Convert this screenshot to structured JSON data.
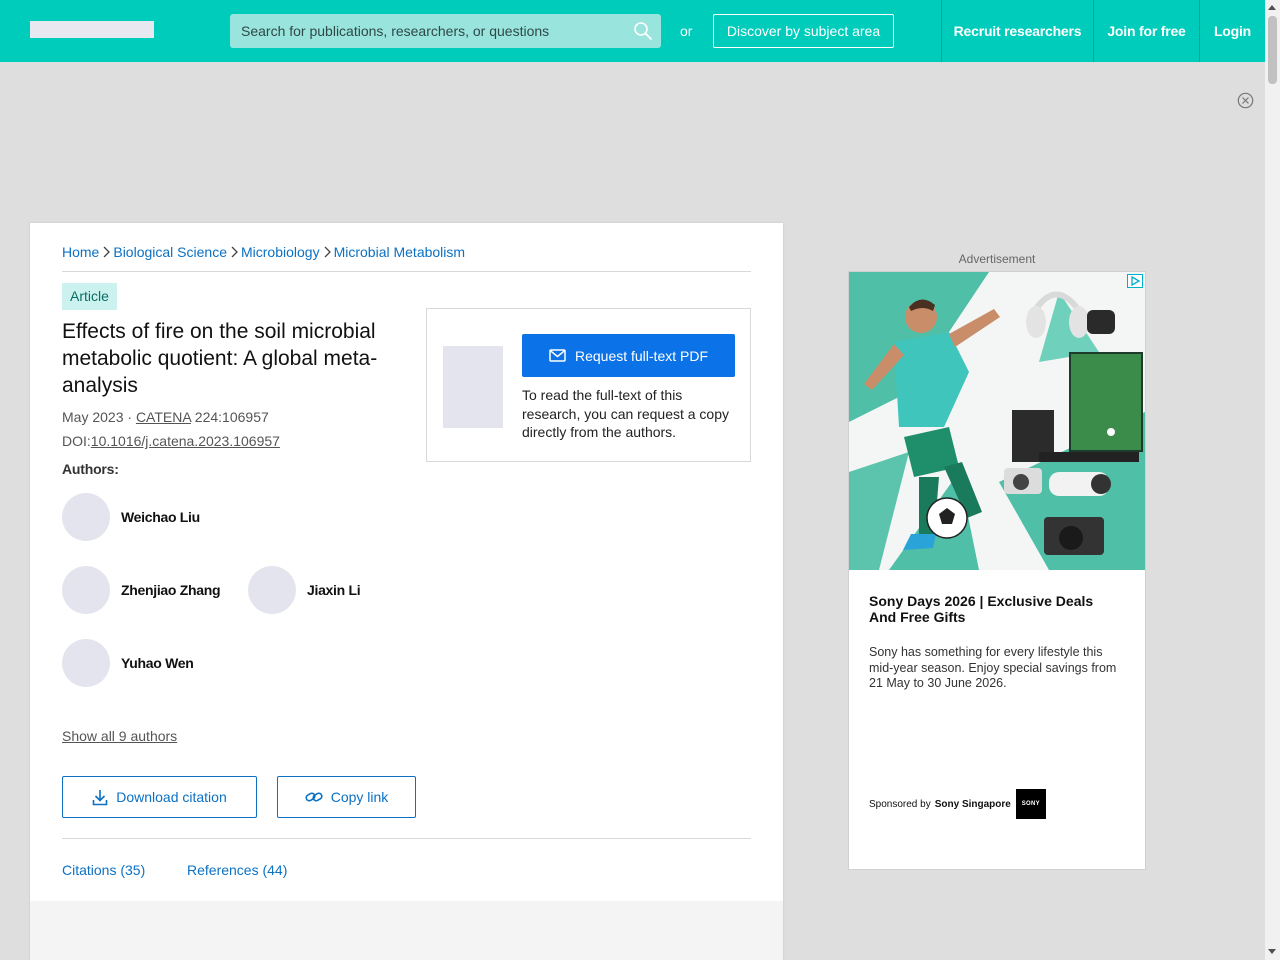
{
  "header": {
    "search_placeholder": "Search for publications, researchers, or questions",
    "or_text": "or",
    "discover_label": "Discover by subject area",
    "nav": [
      "Recruit researchers",
      "Join for free",
      "Login"
    ]
  },
  "breadcrumb": [
    "Home",
    "Biological Science",
    "Microbiology",
    "Microbial Metabolism"
  ],
  "article": {
    "badge": "Article",
    "title": "Effects of fire on the soil microbial metabolic quotient: A global meta-analysis",
    "date": "May 2023 · ",
    "journal": "CATENA",
    "volume": " 224:106957",
    "doi_prefix": "DOI:",
    "doi": "10.1016/j.catena.2023.106957",
    "authors_label": "Authors:",
    "authors": [
      "Weichao Liu",
      "Zhenjiao Zhang",
      "Jiaxin Li",
      "Yuhao Wen"
    ],
    "show_all": "Show all 9 authors",
    "download_citation": "Download citation",
    "copy_link": "Copy link",
    "tabs": [
      "Citations (35)",
      "References (44)"
    ]
  },
  "request": {
    "button": "Request full-text PDF",
    "text": "To read the full-text of this research, you can request a copy directly from the authors."
  },
  "ad": {
    "label": "Advertisement",
    "title": "Sony Days 2026 | Exclusive Deals And Free Gifts",
    "body": "Sony has something for every lifestyle this mid-year season. Enjoy special savings from 21 May to 30 June 2026.",
    "sponsored_by": "Sponsored by",
    "sponsor": "Sony Singapore",
    "logo_text": "SONY"
  },
  "colors": {
    "brand": "#00ccbb",
    "link": "#0c71c3",
    "primary_button": "#0b72e7"
  }
}
